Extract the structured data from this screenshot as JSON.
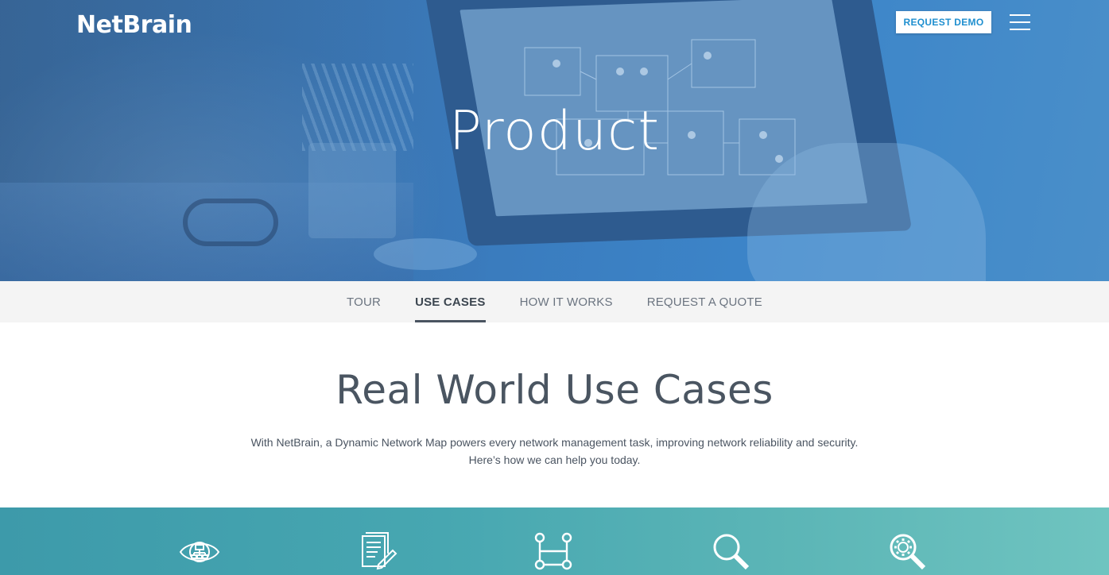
{
  "header": {
    "logo_text": "NetBrain",
    "request_demo_label": "REQUEST DEMO"
  },
  "hero": {
    "title": "Product"
  },
  "subnav": {
    "tabs": [
      {
        "label": "TOUR",
        "active": false
      },
      {
        "label": "USE CASES",
        "active": true
      },
      {
        "label": "HOW IT WORKS",
        "active": false
      },
      {
        "label": "REQUEST A QUOTE",
        "active": false
      }
    ]
  },
  "main": {
    "title": "Real World Use Cases",
    "intro_line1": "With NetBrain, a Dynamic Network Map powers every network management task, improving network reliability and security.",
    "intro_line2": "Here’s how we can help you today."
  },
  "band": {
    "icons": [
      "network-eye-icon",
      "document-edit-icon",
      "workflow-icon",
      "search-icon",
      "gear-search-icon"
    ]
  },
  "colors": {
    "hero_blue": "#3a7bbd",
    "button_text": "#1f8fcf",
    "band_teal": "#47a7b1",
    "heading_gray": "#4a5561"
  }
}
